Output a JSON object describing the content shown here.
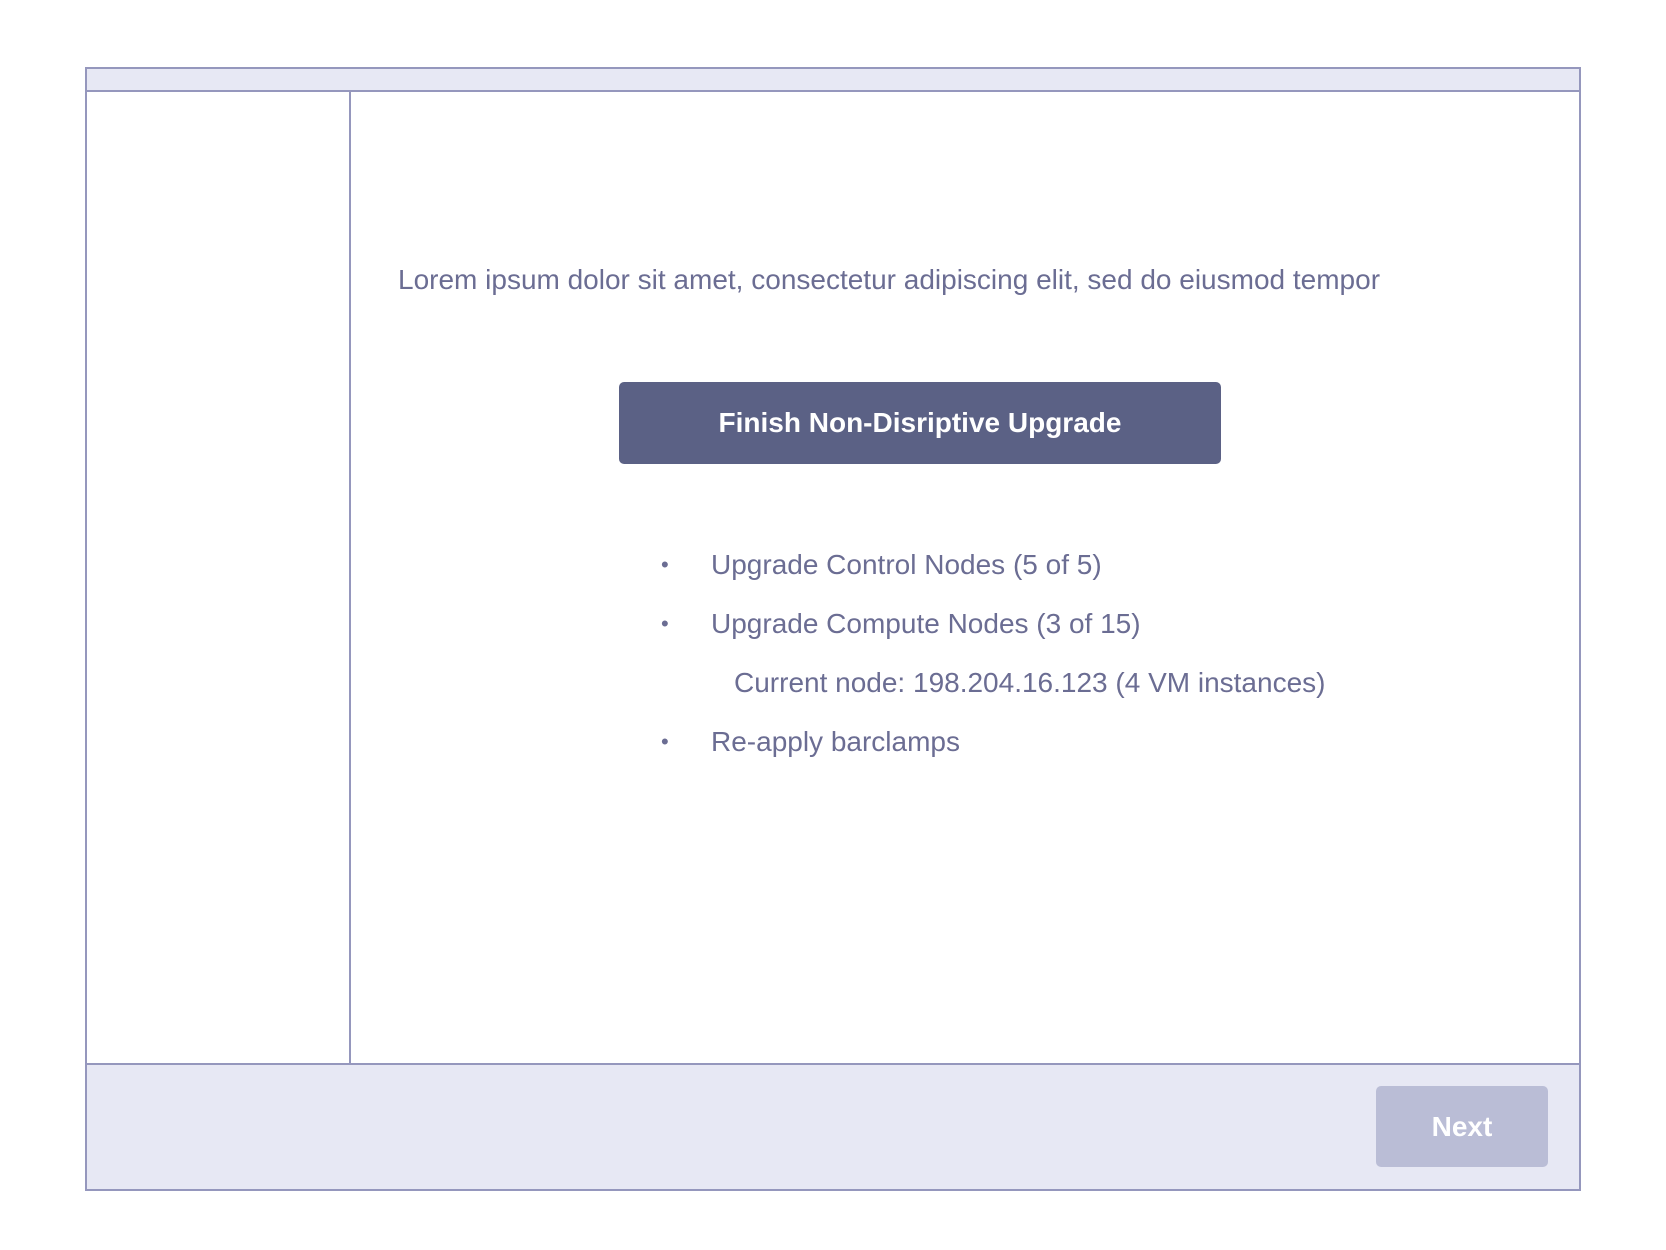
{
  "colors": {
    "border": "#9597bd",
    "chrome_background": "#e7e8f4",
    "text": "#6b6d93",
    "primary_button": "#5b6185",
    "disabled_button": "#babdd6"
  },
  "main": {
    "intro_text": "Lorem ipsum dolor sit amet, consectetur adipiscing elit, sed do eiusmod tempor",
    "primary_button_label": "Finish Non-Disriptive Upgrade",
    "steps": [
      {
        "bullet": "•",
        "label": "Upgrade Control Nodes (5 of 5)"
      },
      {
        "bullet": "•",
        "label": "Upgrade Compute Nodes (3 of 15)"
      },
      {
        "bullet": "",
        "label": "Current node: 198.204.16.123  (4 VM instances)"
      },
      {
        "bullet": "•",
        "label": "Re-apply barclamps"
      }
    ]
  },
  "footer": {
    "next_label": "Next",
    "next_disabled": true
  }
}
